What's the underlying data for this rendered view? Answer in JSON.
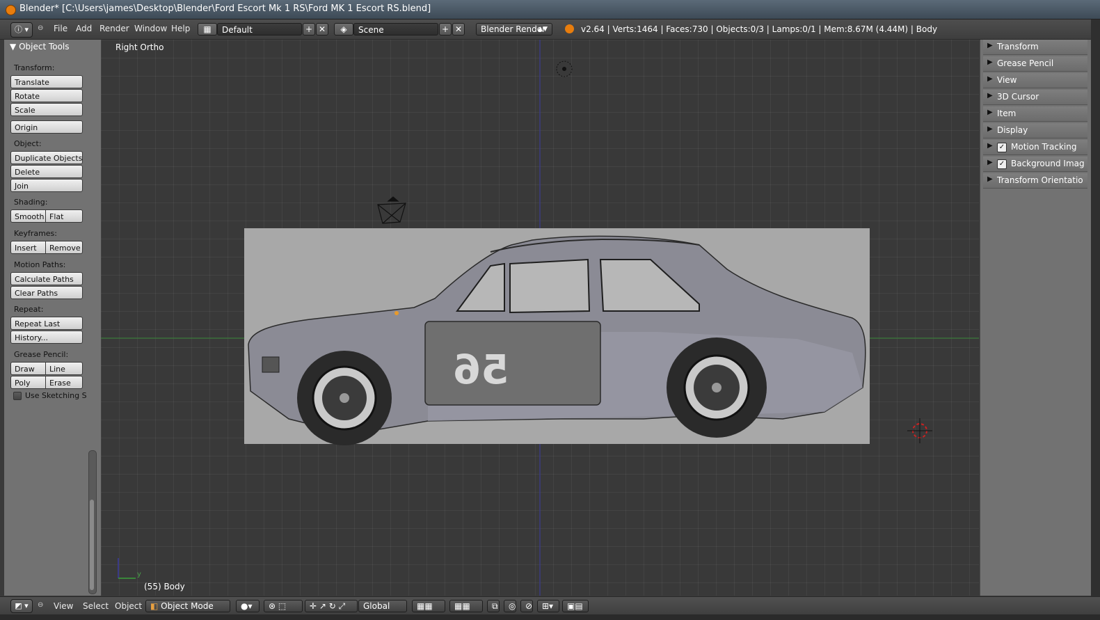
{
  "window": {
    "title": "Blender* [C:\\Users\\james\\Desktop\\Blender\\Ford Escort Mk 1 RS\\Ford MK 1 Escort RS.blend]"
  },
  "info_header": {
    "menus": [
      "File",
      "Add",
      "Render",
      "Window",
      "Help"
    ],
    "screen_layout": "Default",
    "scene": "Scene",
    "render_engine": "Blender Render",
    "stats": "v2.64 | Verts:1464 | Faces:730 | Objects:0/3 | Lamps:0/1 | Mem:8.67M (4.44M) | Body"
  },
  "tool_shelf": {
    "title": "Object Tools",
    "transform_label": "Transform:",
    "translate": "Translate",
    "rotate": "Rotate",
    "scale": "Scale",
    "origin": "Origin",
    "object_label": "Object:",
    "duplicate_objects": "Duplicate Objects",
    "delete": "Delete",
    "join": "Join",
    "shading_label": "Shading:",
    "smooth": "Smooth",
    "flat": "Flat",
    "keyframes_label": "Keyframes:",
    "insert": "Insert",
    "remove": "Remove",
    "motion_paths_label": "Motion Paths:",
    "calculate_paths": "Calculate Paths",
    "clear_paths": "Clear Paths",
    "repeat_label": "Repeat:",
    "repeat_last": "Repeat Last",
    "history": "History...",
    "grease_pencil_label": "Grease Pencil:",
    "draw": "Draw",
    "line": "Line",
    "poly": "Poly",
    "erase": "Erase",
    "use_sketching": "Use Sketching S"
  },
  "viewport": {
    "view_name": "Right Ortho",
    "object_info": "(55) Body",
    "axis_y_label": "y",
    "car_number": "56"
  },
  "properties_panel": {
    "panels": [
      {
        "label": "Transform",
        "checkbox": false
      },
      {
        "label": "Grease Pencil",
        "checkbox": false
      },
      {
        "label": "View",
        "checkbox": false
      },
      {
        "label": "3D Cursor",
        "checkbox": false
      },
      {
        "label": "Item",
        "checkbox": false
      },
      {
        "label": "Display",
        "checkbox": false
      },
      {
        "label": "Motion Tracking",
        "checkbox": true
      },
      {
        "label": "Background Imag",
        "checkbox": true
      },
      {
        "label": "Transform Orientatio",
        "checkbox": false
      }
    ]
  },
  "bottom_header": {
    "menus": [
      "View",
      "Select",
      "Object"
    ],
    "mode": "Object Mode",
    "orientation": "Global"
  },
  "colors": {
    "accent_orange": "#e87d0d",
    "viewport_bg": "#393939",
    "shelf_bg": "#727272",
    "x_axis_green": "#3a8a3a",
    "z_axis_blue": "#3a3aa0"
  }
}
